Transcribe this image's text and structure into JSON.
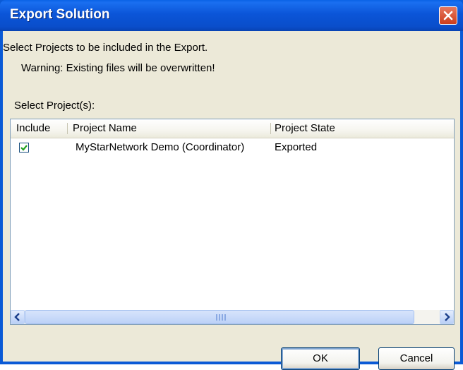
{
  "window": {
    "title": "Export Solution"
  },
  "dialog": {
    "instruction": "Select Projects to be included in the Export.",
    "warning": "Warning: Existing files will be overwritten!",
    "select_label": "Select Project(s):"
  },
  "list": {
    "columns": [
      "Include",
      "Project Name",
      "Project State"
    ],
    "rows": [
      {
        "include": true,
        "name": "MyStarNetwork Demo (Coordinator)",
        "state": "Exported"
      }
    ]
  },
  "buttons": {
    "ok": "OK",
    "cancel": "Cancel"
  },
  "icons": {
    "close": "close-icon",
    "check": "checkmark-icon",
    "scroll_left": "arrow-left-icon",
    "scroll_right": "arrow-right-icon",
    "grip": "grip-icon"
  },
  "colors": {
    "title_bar": "#0a4ecb",
    "client": "#ece9d8",
    "close_button": "#cc3d1c",
    "checkmark": "#21a121"
  }
}
